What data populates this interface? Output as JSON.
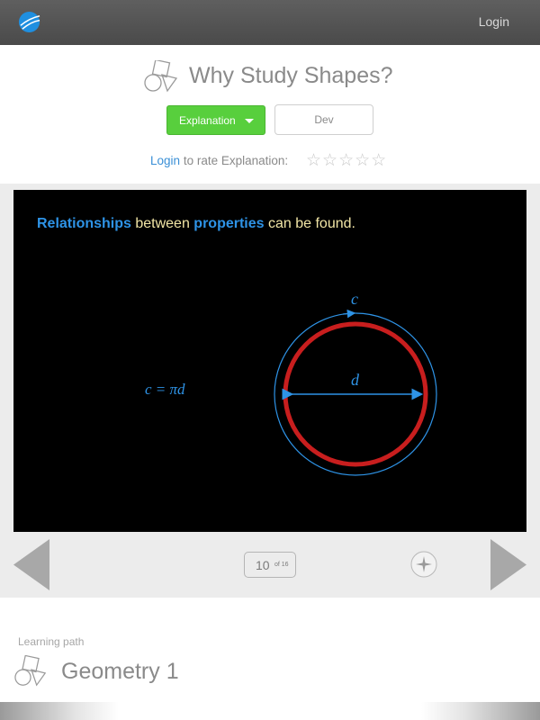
{
  "topbar": {
    "login_label": "Login",
    "logo_icon": "globe-logo-icon"
  },
  "header": {
    "title": "Why Study Shapes?",
    "title_icon": "shapes-icon",
    "explanation_button": "Explanation",
    "dev_button": "Dev",
    "rate_login_link": "Login",
    "rate_text": "to rate Explanation:",
    "stars": "☆☆☆☆☆",
    "rating": 0,
    "rating_max": 5
  },
  "slide": {
    "caption_part1": "Relationships",
    "caption_part2": " between ",
    "caption_part3": "properties",
    "caption_part4": " can be found.",
    "formula": "c = πd",
    "circumference_label": "c",
    "diameter_label": "d",
    "colors": {
      "accent": "#2e93e6",
      "circle": "#c81e1e",
      "caption": "#f2e6a6",
      "background": "#000000"
    }
  },
  "pager": {
    "current": "10",
    "total_label": "of 16"
  },
  "learning_path": {
    "label": "Learning path",
    "title": "Geometry 1",
    "icon": "shapes-icon"
  },
  "colors": {
    "accent_green": "#58cf3d",
    "link_blue": "#3a8fd6"
  }
}
